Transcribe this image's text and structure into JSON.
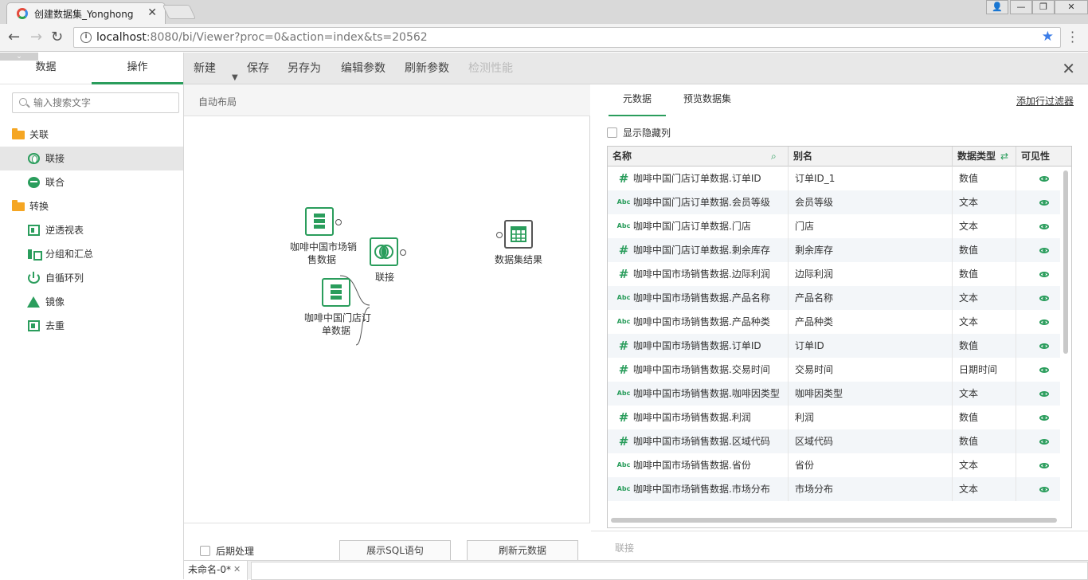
{
  "browser": {
    "tab_title": "创建数据集_Yonghong",
    "url_host": "localhost",
    "url_rest": ":8080/bi/Viewer?proc=0&action=index&ts=20562"
  },
  "sidebar": {
    "tabs": [
      "数据",
      "操作"
    ],
    "search_placeholder": "输入搜索文字",
    "groups": [
      {
        "label": "关联",
        "items": [
          "联接",
          "联合"
        ]
      },
      {
        "label": "转换",
        "items": [
          "逆透视表",
          "分组和汇总",
          "自循环列",
          "镜像",
          "去重"
        ]
      }
    ]
  },
  "toolbar": {
    "new": "新建",
    "save": "保存",
    "save_as": "另存为",
    "edit_params": "编辑参数",
    "refresh_params": "刷新参数",
    "check_perf": "检测性能"
  },
  "canvas": {
    "auto_layout": "自动布局",
    "nodes": {
      "src1_line1": "咖啡中国市场销",
      "src1_line2": "售数据",
      "join": "联接",
      "src2_line1": "咖啡中国门店订",
      "src2_line2": "单数据",
      "result": "数据集结果"
    },
    "post_process": "后期处理",
    "show_sql": "展示SQL语句",
    "refresh_meta": "刷新元数据"
  },
  "rpanel": {
    "tabs": [
      "元数据",
      "预览数据集"
    ],
    "add_filter": "添加行过滤器",
    "show_hidden": "显示隐藏列",
    "columns": {
      "name": "名称",
      "alias": "别名",
      "type": "数据类型",
      "visible": "可见性"
    },
    "rows": [
      {
        "kind": "num",
        "name": "咖啡中国门店订单数据.订单ID",
        "alias": "订单ID_1",
        "type": "数值"
      },
      {
        "kind": "txt",
        "name": "咖啡中国门店订单数据.会员等级",
        "alias": "会员等级",
        "type": "文本"
      },
      {
        "kind": "txt",
        "name": "咖啡中国门店订单数据.门店",
        "alias": "门店",
        "type": "文本"
      },
      {
        "kind": "num",
        "name": "咖啡中国门店订单数据.剩余库存",
        "alias": "剩余库存",
        "type": "数值"
      },
      {
        "kind": "num",
        "name": "咖啡中国市场销售数据.边际利润",
        "alias": "边际利润",
        "type": "数值"
      },
      {
        "kind": "txt",
        "name": "咖啡中国市场销售数据.产品名称",
        "alias": "产品名称",
        "type": "文本"
      },
      {
        "kind": "txt",
        "name": "咖啡中国市场销售数据.产品种类",
        "alias": "产品种类",
        "type": "文本"
      },
      {
        "kind": "num",
        "name": "咖啡中国市场销售数据.订单ID",
        "alias": "订单ID",
        "type": "数值"
      },
      {
        "kind": "num",
        "name": "咖啡中国市场销售数据.交易时间",
        "alias": "交易时间",
        "type": "日期时间"
      },
      {
        "kind": "txt",
        "name": "咖啡中国市场销售数据.咖啡因类型",
        "alias": "咖啡因类型",
        "type": "文本"
      },
      {
        "kind": "num",
        "name": "咖啡中国市场销售数据.利润",
        "alias": "利润",
        "type": "数值"
      },
      {
        "kind": "num",
        "name": "咖啡中国市场销售数据.区域代码",
        "alias": "区域代码",
        "type": "数值"
      },
      {
        "kind": "txt",
        "name": "咖啡中国市场销售数据.省份",
        "alias": "省份",
        "type": "文本"
      },
      {
        "kind": "txt",
        "name": "咖啡中国市场销售数据.市场分布",
        "alias": "市场分布",
        "type": "文本"
      }
    ],
    "footer_label": "联接"
  },
  "doc_tab": "未命名-0*",
  "colors": {
    "accent": "#2a9d5c",
    "folder": "#f5a623"
  }
}
